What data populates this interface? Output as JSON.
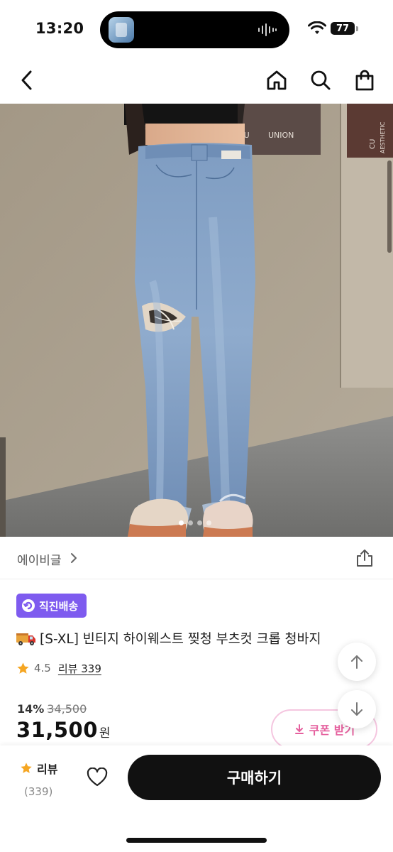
{
  "status_bar": {
    "time": "13:20",
    "battery": "77"
  },
  "nav": {
    "back_icon": "chevron-left-icon",
    "home_icon": "home-icon",
    "search_icon": "search-icon",
    "cart_icon": "shopping-bag-icon"
  },
  "product_image": {
    "alt_subject": "vintage distressed light-wash bootcut jeans",
    "sign_text": "UNION",
    "sign_text_2": "CU",
    "sign_text_3": "AESTHETIC",
    "dot_count": 4,
    "active_dot": 0
  },
  "seller": {
    "name": "에이비글",
    "chevron_icon": "chevron-right-icon",
    "share_icon": "share-icon"
  },
  "badge": {
    "label": "직진배송",
    "color": "#7e5bef"
  },
  "product": {
    "title": "[S-XL] 빈티지 하이웨스트 찢청 부츠컷 크롭 청바지",
    "title_icon": "delivery-truck-icon",
    "rating": "4.5",
    "review_link": "리뷰 339"
  },
  "price": {
    "discount_rate": "14%",
    "original": "34,500",
    "final": "31,500",
    "unit": "원"
  },
  "coupon": {
    "label": "쿠폰 받기",
    "color": "#e5609e"
  },
  "scroll": {
    "up_icon": "arrow-up-icon",
    "down_icon": "arrow-down-icon"
  },
  "bottom_bar": {
    "review_label": "리뷰",
    "review_count": "(339)",
    "wishlist_icon": "heart-icon",
    "buy_label": "구매하기"
  }
}
